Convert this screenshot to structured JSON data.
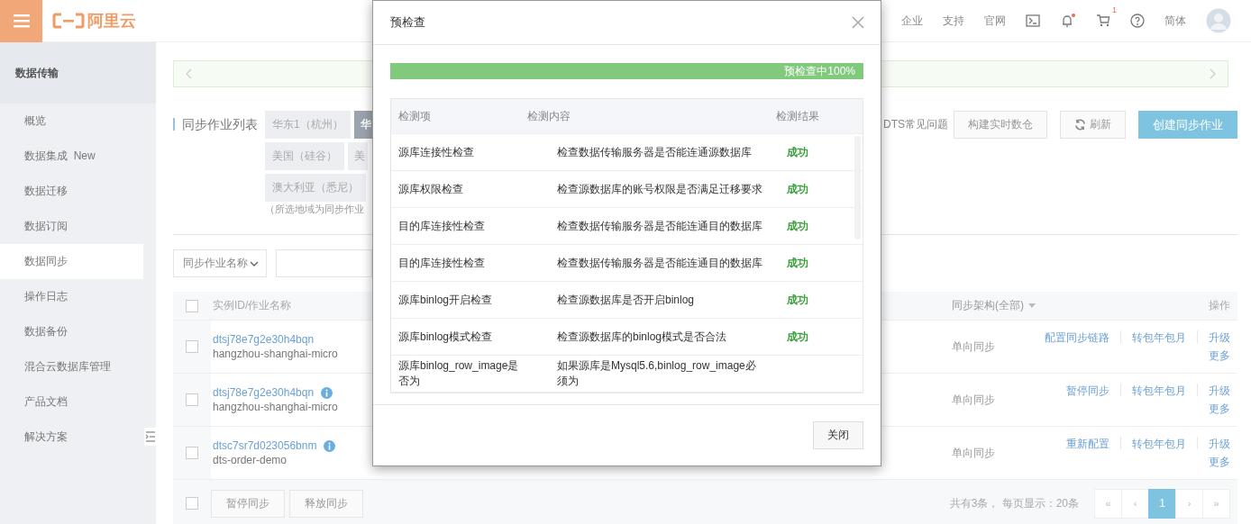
{
  "header": {
    "logo_text": "阿里云",
    "nav": [
      "企业",
      "支持",
      "官网"
    ],
    "notification_unread": true,
    "cart_count": "1",
    "language": "简体"
  },
  "sidebar": {
    "title": "数据传输",
    "items": [
      {
        "label": "概览",
        "selected": false
      },
      {
        "label": "数据集成",
        "badge": "New",
        "selected": false
      },
      {
        "label": "数据迁移",
        "selected": false
      },
      {
        "label": "数据订阅",
        "selected": false
      },
      {
        "label": "数据同步",
        "selected": true
      },
      {
        "label": "操作日志",
        "selected": false
      },
      {
        "label": "数据备份",
        "selected": false
      },
      {
        "label": "混合云数据库管理",
        "selected": false
      },
      {
        "label": "产品文档",
        "selected": false
      },
      {
        "label": "解决方案",
        "selected": false
      }
    ]
  },
  "job_list": {
    "title": "同步作业列表",
    "region_rows": [
      [
        {
          "label": "华东1（杭州）",
          "selected": false
        },
        {
          "label": "华",
          "selected": true
        }
      ],
      [
        {
          "label": "美国（硅谷）",
          "selected": false
        },
        {
          "label": "美",
          "selected": false
        }
      ],
      [
        {
          "label": "澳大利亚（悉尼）",
          "selected": false
        }
      ]
    ],
    "note": "（所选地域为同步作业"
  },
  "toolbar": {
    "faq_link": "DTS常见问题",
    "buttons": [
      {
        "kind": "plain",
        "label": "构建实时数仓"
      },
      {
        "kind": "refresh",
        "label": "刷新"
      },
      {
        "kind": "primary",
        "label": "创建同步作业"
      }
    ]
  },
  "filter": {
    "field_select": "同步作业名称"
  },
  "table": {
    "all_checked": false,
    "columns": [
      "实例ID/作业名称",
      "同步架构(全部)",
      "操作"
    ],
    "rows": [
      {
        "checked": false,
        "id": "dtsj78e7g2e30h4bqn",
        "name": "hangzhou-shanghai-micro",
        "info": false,
        "architecture": "单向同步",
        "actions": [
          "配置同步链路",
          "转包年包月"
        ],
        "more": [
          "升级",
          "更多"
        ]
      },
      {
        "checked": false,
        "id": "dtsj78e7g2e30h4bqn",
        "name": "hangzhou-shanghai-micro",
        "info": true,
        "architecture": "单向同步",
        "actions": [
          "暂停同步",
          "转包年包月"
        ],
        "more": [
          "升级",
          "更多"
        ]
      },
      {
        "checked": false,
        "id": "dtsc7sr7d023056bnm",
        "name": "dts-order-demo",
        "info": true,
        "architecture": "单向同步",
        "actions": [
          "重新配置",
          "转包年包月"
        ],
        "more": [
          "升级",
          "更多"
        ]
      }
    ]
  },
  "bulk": {
    "checked": false,
    "buttons": [
      {
        "label": "暂停同步",
        "disabled": true
      },
      {
        "label": "释放同步",
        "disabled": true
      }
    ]
  },
  "pagination": {
    "summary": "共有3条， 每页显示：20条",
    "first": "«",
    "prev": "‹",
    "pages": [
      {
        "label": "1",
        "selected": true
      }
    ],
    "next": "›",
    "last": "»"
  },
  "dialog": {
    "title": "预检查",
    "progress": {
      "level": 1,
      "label": "预检查中100%"
    },
    "columns": [
      "检测项",
      "检测内容",
      "检测结果"
    ],
    "rows": [
      {
        "item": "源库连接性检查",
        "content": "检查数据传输服务器是否能连通源数据库",
        "result": "成功",
        "passed": true
      },
      {
        "item": "源库权限检查",
        "content": "检查源数据库的账号权限是否满足迁移要求",
        "result": "成功",
        "passed": true
      },
      {
        "item": "目的库连接性检查",
        "content": "检查数据传输服务器是否能连通目的数据库",
        "result": "成功",
        "passed": true
      },
      {
        "item": "目的库连接性检查",
        "content": "检查数据传输服务器是否能连通目的数据库",
        "result": "成功",
        "passed": true
      },
      {
        "item": "源库binlog开启检查",
        "content": "检查源数据库是否开启binlog",
        "result": "成功",
        "passed": true
      },
      {
        "item": "源库binlog模式检查",
        "content": "检查源数据库的binlog模式是否合法",
        "result": "成功",
        "passed": true
      },
      {
        "item": "源库binlog_row_image是否为",
        "content": "如果源库是Mysql5.6,binlog_row_image必须为"
      }
    ],
    "close_button": "关闭"
  }
}
